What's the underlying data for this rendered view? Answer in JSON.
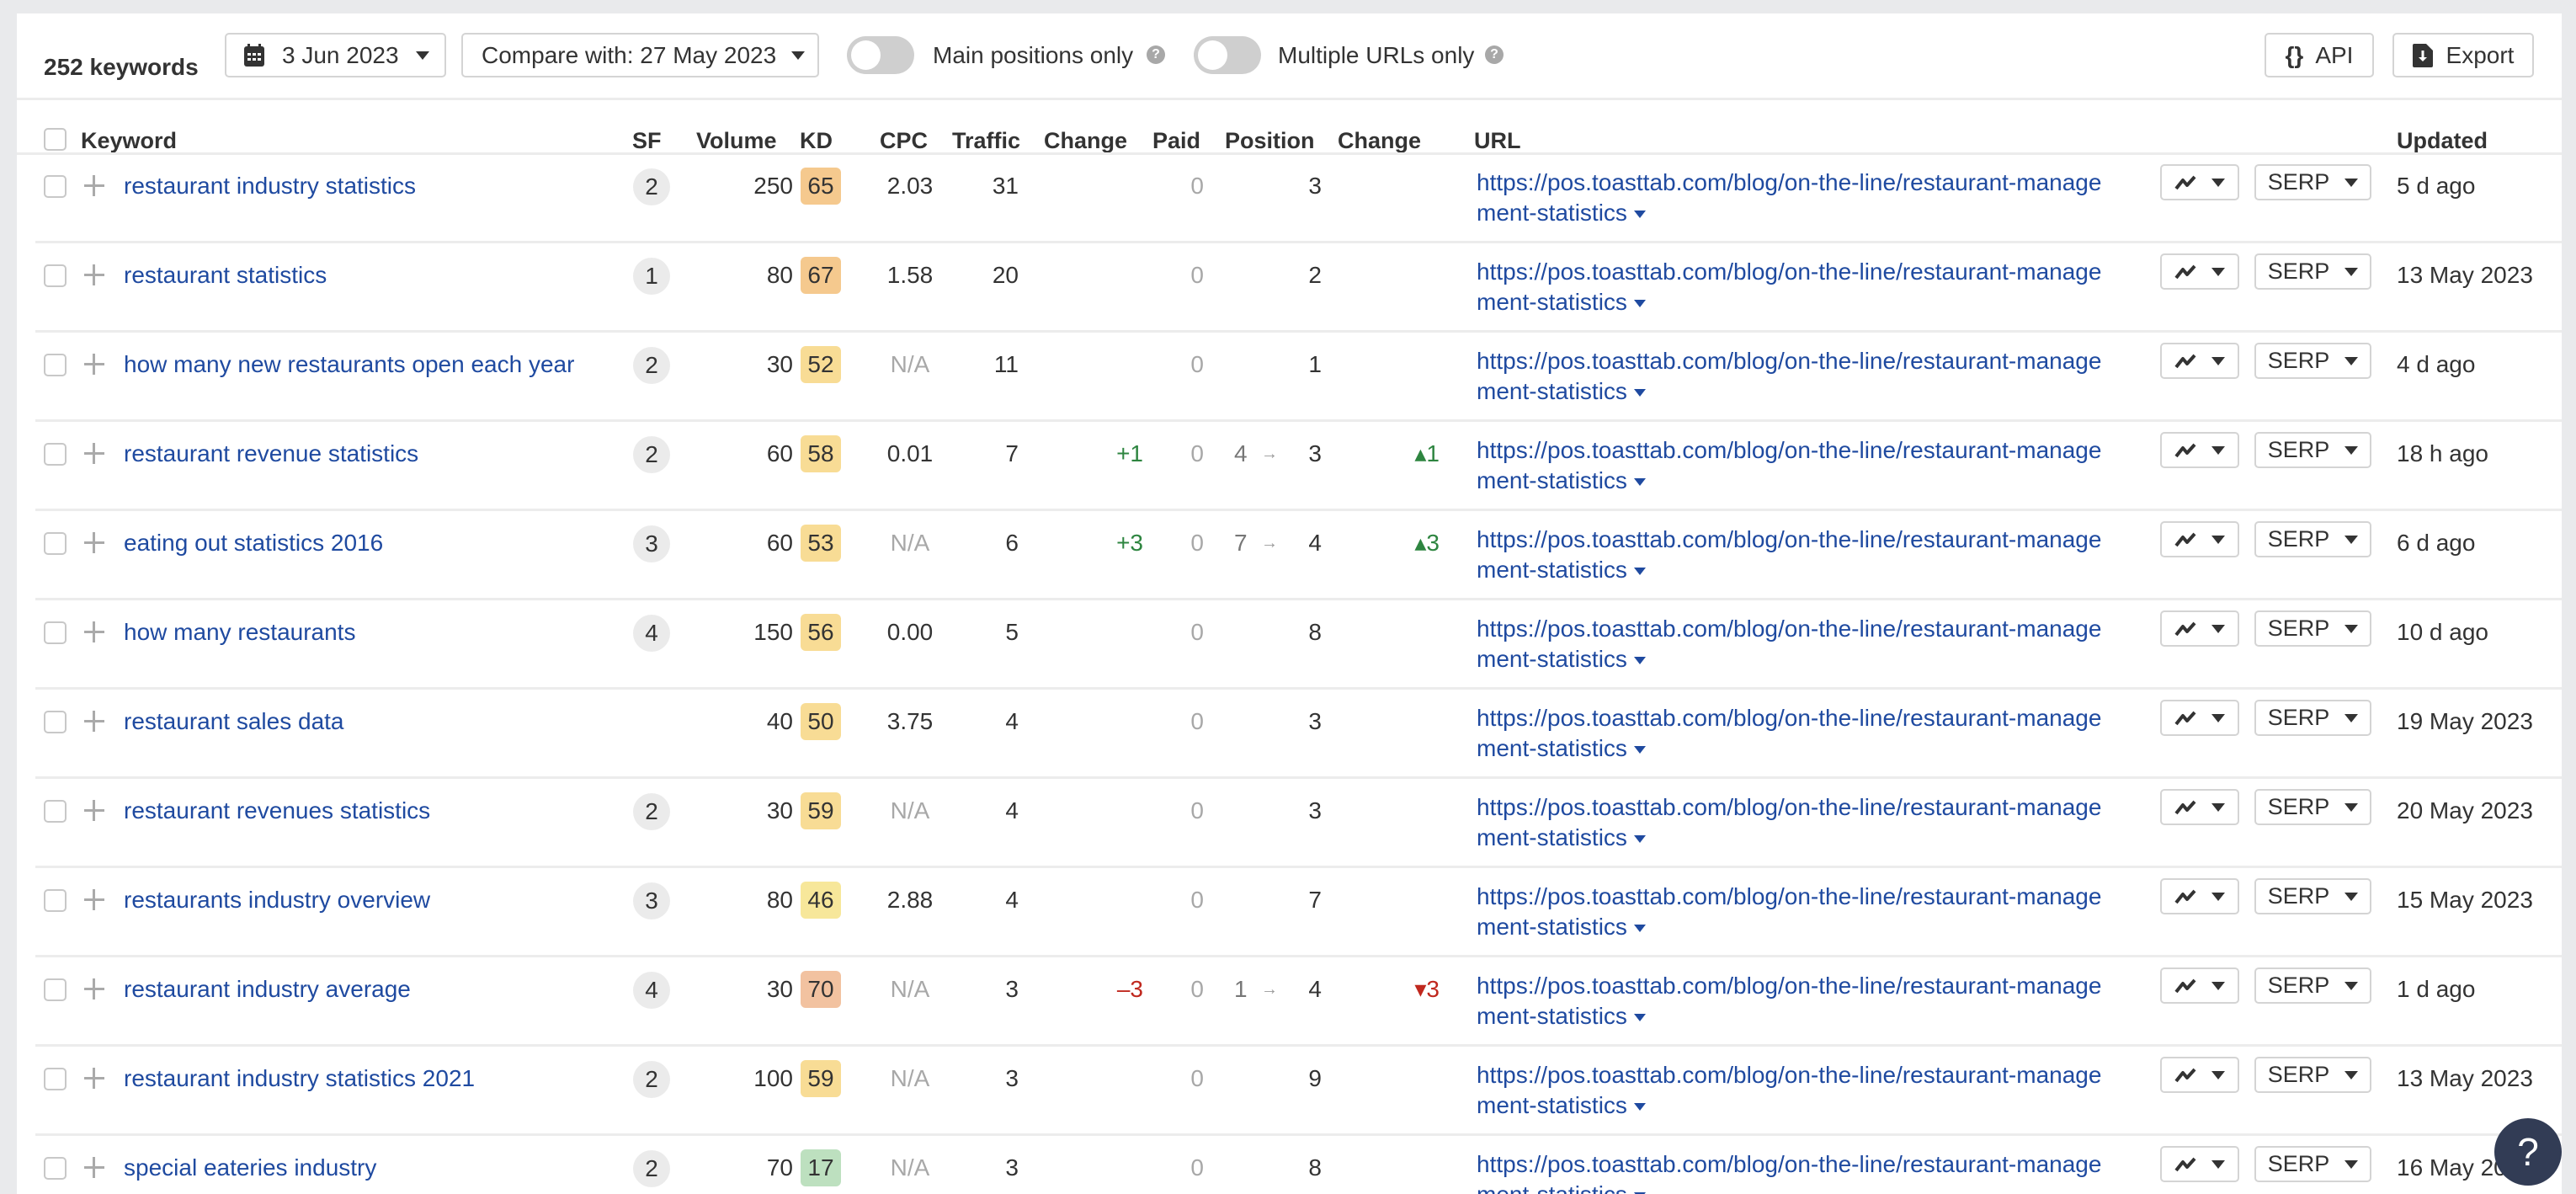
{
  "toolbar": {
    "keyword_count": "252 keywords",
    "date_label": "3 Jun 2023",
    "compare_label": "Compare with: 27 May 2023",
    "toggle_main_positions": {
      "label": "Main positions only",
      "on": false
    },
    "toggle_multiple_urls": {
      "label": "Multiple URLs only",
      "on": false
    },
    "api_label": "API",
    "export_label": "Export"
  },
  "columns": {
    "keyword": "Keyword",
    "sf": "SF",
    "volume": "Volume",
    "kd": "KD",
    "cpc": "CPC",
    "traffic": "Traffic",
    "traffic_change": "Change",
    "paid": "Paid",
    "position": "Position",
    "position_change": "Change",
    "url": "URL",
    "updated": "Updated"
  },
  "colors": {
    "link": "#1f4aa0",
    "positive": "#2e8540",
    "negative": "#c0281e",
    "kd_orange": "#f5c98e",
    "kd_yellow": "#f8dc95",
    "kd_light_yellow": "#f7e79a",
    "kd_red_orange": "#f2c2a0",
    "kd_green": "#bde0bf"
  },
  "url_dropdown_caret": "caret-down-icon",
  "chart_button_icon": "line-chart-icon",
  "serp_label": "SERP",
  "rows": [
    {
      "keyword": "restaurant industry statistics",
      "sf": "2",
      "volume": "250",
      "kd": "65",
      "kd_color": "#f5c98e",
      "cpc": "2.03",
      "cpc_na": false,
      "traffic": "31",
      "traffic_change": "",
      "paid": "0",
      "pos_prev": "",
      "position": "3",
      "pos_change": "",
      "pos_dir": "",
      "url_line1": "https://pos.toasttab.com/blog/on-the-line/restaurant-manage",
      "url_line2": "ment-statistics",
      "updated": "5 d ago"
    },
    {
      "keyword": "restaurant statistics",
      "sf": "1",
      "volume": "80",
      "kd": "67",
      "kd_color": "#f5c98e",
      "cpc": "1.58",
      "cpc_na": false,
      "traffic": "20",
      "traffic_change": "",
      "paid": "0",
      "pos_prev": "",
      "position": "2",
      "pos_change": "",
      "pos_dir": "",
      "url_line1": "https://pos.toasttab.com/blog/on-the-line/restaurant-manage",
      "url_line2": "ment-statistics",
      "updated": "13 May 2023"
    },
    {
      "keyword": "how many new restaurants open each year",
      "sf": "2",
      "volume": "30",
      "kd": "52",
      "kd_color": "#f8dc95",
      "cpc": "N/A",
      "cpc_na": true,
      "traffic": "11",
      "traffic_change": "",
      "paid": "0",
      "pos_prev": "",
      "position": "1",
      "pos_change": "",
      "pos_dir": "",
      "url_line1": "https://pos.toasttab.com/blog/on-the-line/restaurant-manage",
      "url_line2": "ment-statistics",
      "updated": "4 d ago"
    },
    {
      "keyword": "restaurant revenue statistics",
      "sf": "2",
      "volume": "60",
      "kd": "58",
      "kd_color": "#f8dc95",
      "cpc": "0.01",
      "cpc_na": false,
      "traffic": "7",
      "traffic_change": "+1",
      "paid": "0",
      "pos_prev": "4",
      "position": "3",
      "pos_change": "1",
      "pos_dir": "up",
      "url_line1": "https://pos.toasttab.com/blog/on-the-line/restaurant-manage",
      "url_line2": "ment-statistics",
      "updated": "18 h ago"
    },
    {
      "keyword": "eating out statistics 2016",
      "sf": "3",
      "volume": "60",
      "kd": "53",
      "kd_color": "#f8dc95",
      "cpc": "N/A",
      "cpc_na": true,
      "traffic": "6",
      "traffic_change": "+3",
      "paid": "0",
      "pos_prev": "7",
      "position": "4",
      "pos_change": "3",
      "pos_dir": "up",
      "url_line1": "https://pos.toasttab.com/blog/on-the-line/restaurant-manage",
      "url_line2": "ment-statistics",
      "updated": "6 d ago"
    },
    {
      "keyword": "how many restaurants",
      "sf": "4",
      "volume": "150",
      "kd": "56",
      "kd_color": "#f8dc95",
      "cpc": "0.00",
      "cpc_na": false,
      "traffic": "5",
      "traffic_change": "",
      "paid": "0",
      "pos_prev": "",
      "position": "8",
      "pos_change": "",
      "pos_dir": "",
      "url_line1": "https://pos.toasttab.com/blog/on-the-line/restaurant-manage",
      "url_line2": "ment-statistics",
      "updated": "10 d ago"
    },
    {
      "keyword": "restaurant sales data",
      "sf": "",
      "volume": "40",
      "kd": "50",
      "kd_color": "#f8dc95",
      "cpc": "3.75",
      "cpc_na": false,
      "traffic": "4",
      "traffic_change": "",
      "paid": "0",
      "pos_prev": "",
      "position": "3",
      "pos_change": "",
      "pos_dir": "",
      "url_line1": "https://pos.toasttab.com/blog/on-the-line/restaurant-manage",
      "url_line2": "ment-statistics",
      "updated": "19 May 2023"
    },
    {
      "keyword": "restaurant revenues statistics",
      "sf": "2",
      "volume": "30",
      "kd": "59",
      "kd_color": "#f8dc95",
      "cpc": "N/A",
      "cpc_na": true,
      "traffic": "4",
      "traffic_change": "",
      "paid": "0",
      "pos_prev": "",
      "position": "3",
      "pos_change": "",
      "pos_dir": "",
      "url_line1": "https://pos.toasttab.com/blog/on-the-line/restaurant-manage",
      "url_line2": "ment-statistics",
      "updated": "20 May 2023"
    },
    {
      "keyword": "restaurants industry overview",
      "sf": "3",
      "volume": "80",
      "kd": "46",
      "kd_color": "#f7e79a",
      "cpc": "2.88",
      "cpc_na": false,
      "traffic": "4",
      "traffic_change": "",
      "paid": "0",
      "pos_prev": "",
      "position": "7",
      "pos_change": "",
      "pos_dir": "",
      "url_line1": "https://pos.toasttab.com/blog/on-the-line/restaurant-manage",
      "url_line2": "ment-statistics",
      "updated": "15 May 2023"
    },
    {
      "keyword": "restaurant industry average",
      "sf": "4",
      "volume": "30",
      "kd": "70",
      "kd_color": "#f2c2a0",
      "cpc": "N/A",
      "cpc_na": true,
      "traffic": "3",
      "traffic_change": "–3",
      "paid": "0",
      "pos_prev": "1",
      "position": "4",
      "pos_change": "3",
      "pos_dir": "down",
      "url_line1": "https://pos.toasttab.com/blog/on-the-line/restaurant-manage",
      "url_line2": "ment-statistics",
      "updated": "1 d ago"
    },
    {
      "keyword": "restaurant industry statistics 2021",
      "sf": "2",
      "volume": "100",
      "kd": "59",
      "kd_color": "#f8dc95",
      "cpc": "N/A",
      "cpc_na": true,
      "traffic": "3",
      "traffic_change": "",
      "paid": "0",
      "pos_prev": "",
      "position": "9",
      "pos_change": "",
      "pos_dir": "",
      "url_line1": "https://pos.toasttab.com/blog/on-the-line/restaurant-manage",
      "url_line2": "ment-statistics",
      "updated": "13 May 2023"
    },
    {
      "keyword": "special eateries industry",
      "sf": "2",
      "volume": "70",
      "kd": "17",
      "kd_color": "#bde0bf",
      "cpc": "N/A",
      "cpc_na": true,
      "traffic": "3",
      "traffic_change": "",
      "paid": "0",
      "pos_prev": "",
      "position": "8",
      "pos_change": "",
      "pos_dir": "",
      "url_line1": "https://pos.toasttab.com/blog/on-the-line/restaurant-manage",
      "url_line2": "ment-statistics",
      "updated": "16 May 2023"
    }
  ],
  "help_button": "?"
}
